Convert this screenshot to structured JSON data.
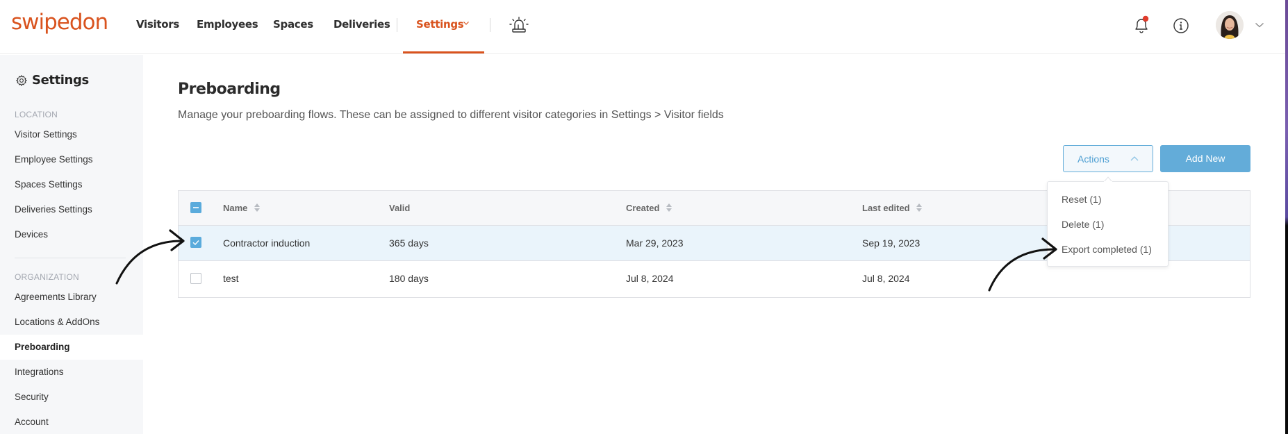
{
  "brand": {
    "logo_text": "swipedon",
    "accent": "#d9531e",
    "primary_blue": "#5aabdc"
  },
  "header": {
    "nav": [
      {
        "label": "Visitors"
      },
      {
        "label": "Employees"
      },
      {
        "label": "Spaces"
      },
      {
        "label": "Deliveries"
      },
      {
        "label": "Settings",
        "active": true
      }
    ],
    "icons": [
      "alarm-light-icon",
      "bell-icon",
      "info-icon",
      "avatar",
      "chevron-down-icon"
    ],
    "notification_dot": true
  },
  "sidebar": {
    "title": "Settings",
    "sections": [
      {
        "label": "LOCATION",
        "items": [
          {
            "label": "Visitor Settings"
          },
          {
            "label": "Employee Settings"
          },
          {
            "label": "Spaces Settings"
          },
          {
            "label": "Deliveries Settings"
          },
          {
            "label": "Devices"
          }
        ]
      },
      {
        "label": "ORGANIZATION",
        "items": [
          {
            "label": "Agreements Library"
          },
          {
            "label": "Locations & AddOns"
          },
          {
            "label": "Preboarding",
            "active": true
          },
          {
            "label": "Integrations"
          },
          {
            "label": "Security"
          },
          {
            "label": "Account"
          }
        ]
      }
    ]
  },
  "main": {
    "title": "Preboarding",
    "description": "Manage your preboarding flows. These can be assigned to different visitor categories in Settings > Visitor fields",
    "actions_button": "Actions",
    "add_button": "Add New",
    "actions_menu": [
      {
        "label": "Reset (1)"
      },
      {
        "label": "Delete (1)"
      },
      {
        "label": "Export completed (1)"
      }
    ],
    "table": {
      "columns": [
        {
          "label": "Name",
          "sortable": true
        },
        {
          "label": "Valid",
          "sortable": false
        },
        {
          "label": "Created",
          "sortable": true
        },
        {
          "label": "Last edited",
          "sortable": true
        }
      ],
      "header_checkbox": "indeterminate",
      "rows": [
        {
          "selected": true,
          "name": "Contractor induction",
          "valid": "365 days",
          "created": "Mar 29, 2023",
          "last_edited": "Sep 19, 2023"
        },
        {
          "selected": false,
          "name": "test",
          "valid": "180 days",
          "created": "Jul 8, 2024",
          "last_edited": "Jul 8, 2024"
        }
      ]
    }
  }
}
